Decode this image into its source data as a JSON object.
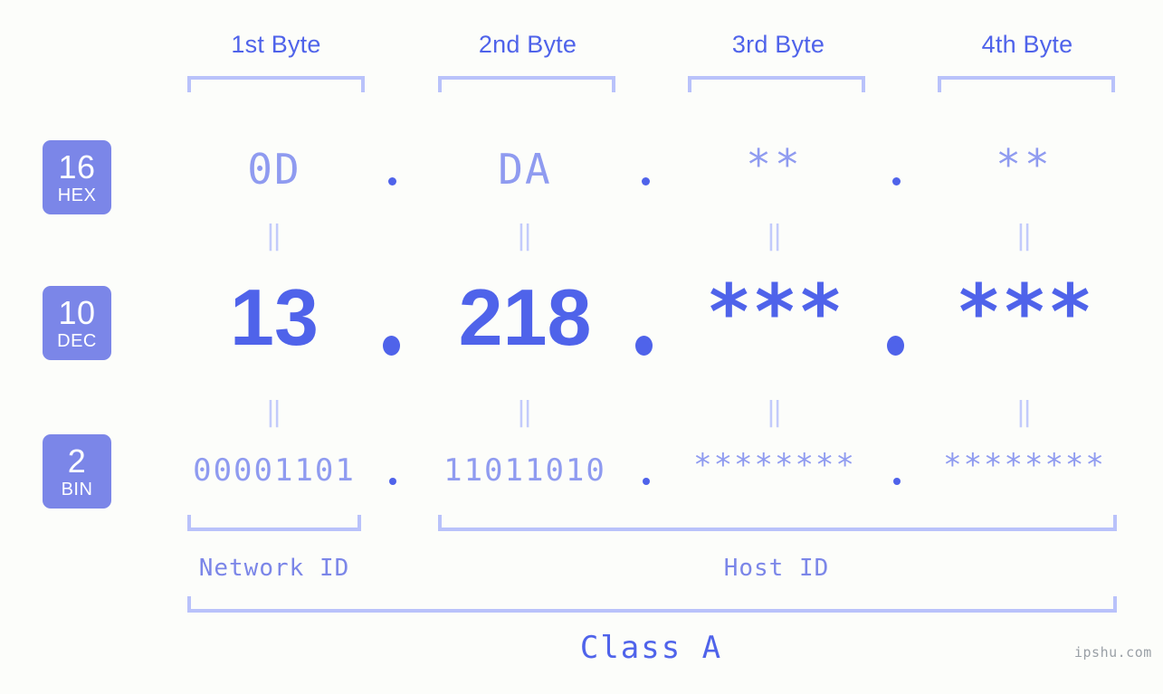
{
  "meta": {
    "watermark": "ipshu.com",
    "background_color": "#fcfdfa",
    "accent_color": "#4f63ea",
    "badge_color": "#7b86e8",
    "light_value_color": "#8f9bf0",
    "bracket_color": "#b9c2fa"
  },
  "byte_headers": [
    {
      "label": "1st Byte"
    },
    {
      "label": "2nd Byte"
    },
    {
      "label": "3rd Byte"
    },
    {
      "label": "4th Byte"
    }
  ],
  "rows": [
    {
      "badge": {
        "number": "16",
        "label": "HEX"
      },
      "values": [
        "0D",
        "DA",
        "**",
        "**"
      ],
      "separator": "."
    },
    {
      "badge": {
        "number": "10",
        "label": "DEC"
      },
      "values": [
        "13",
        "218",
        "***",
        "***"
      ],
      "separator": "."
    },
    {
      "badge": {
        "number": "2",
        "label": "BIN"
      },
      "values": [
        "00001101",
        "11011010",
        "********",
        "********"
      ],
      "separator": "."
    }
  ],
  "connectors": {
    "glyph": "‖"
  },
  "segments": [
    {
      "label": "Network ID"
    },
    {
      "label": "Host ID"
    }
  ],
  "class": {
    "label": "Class A"
  }
}
